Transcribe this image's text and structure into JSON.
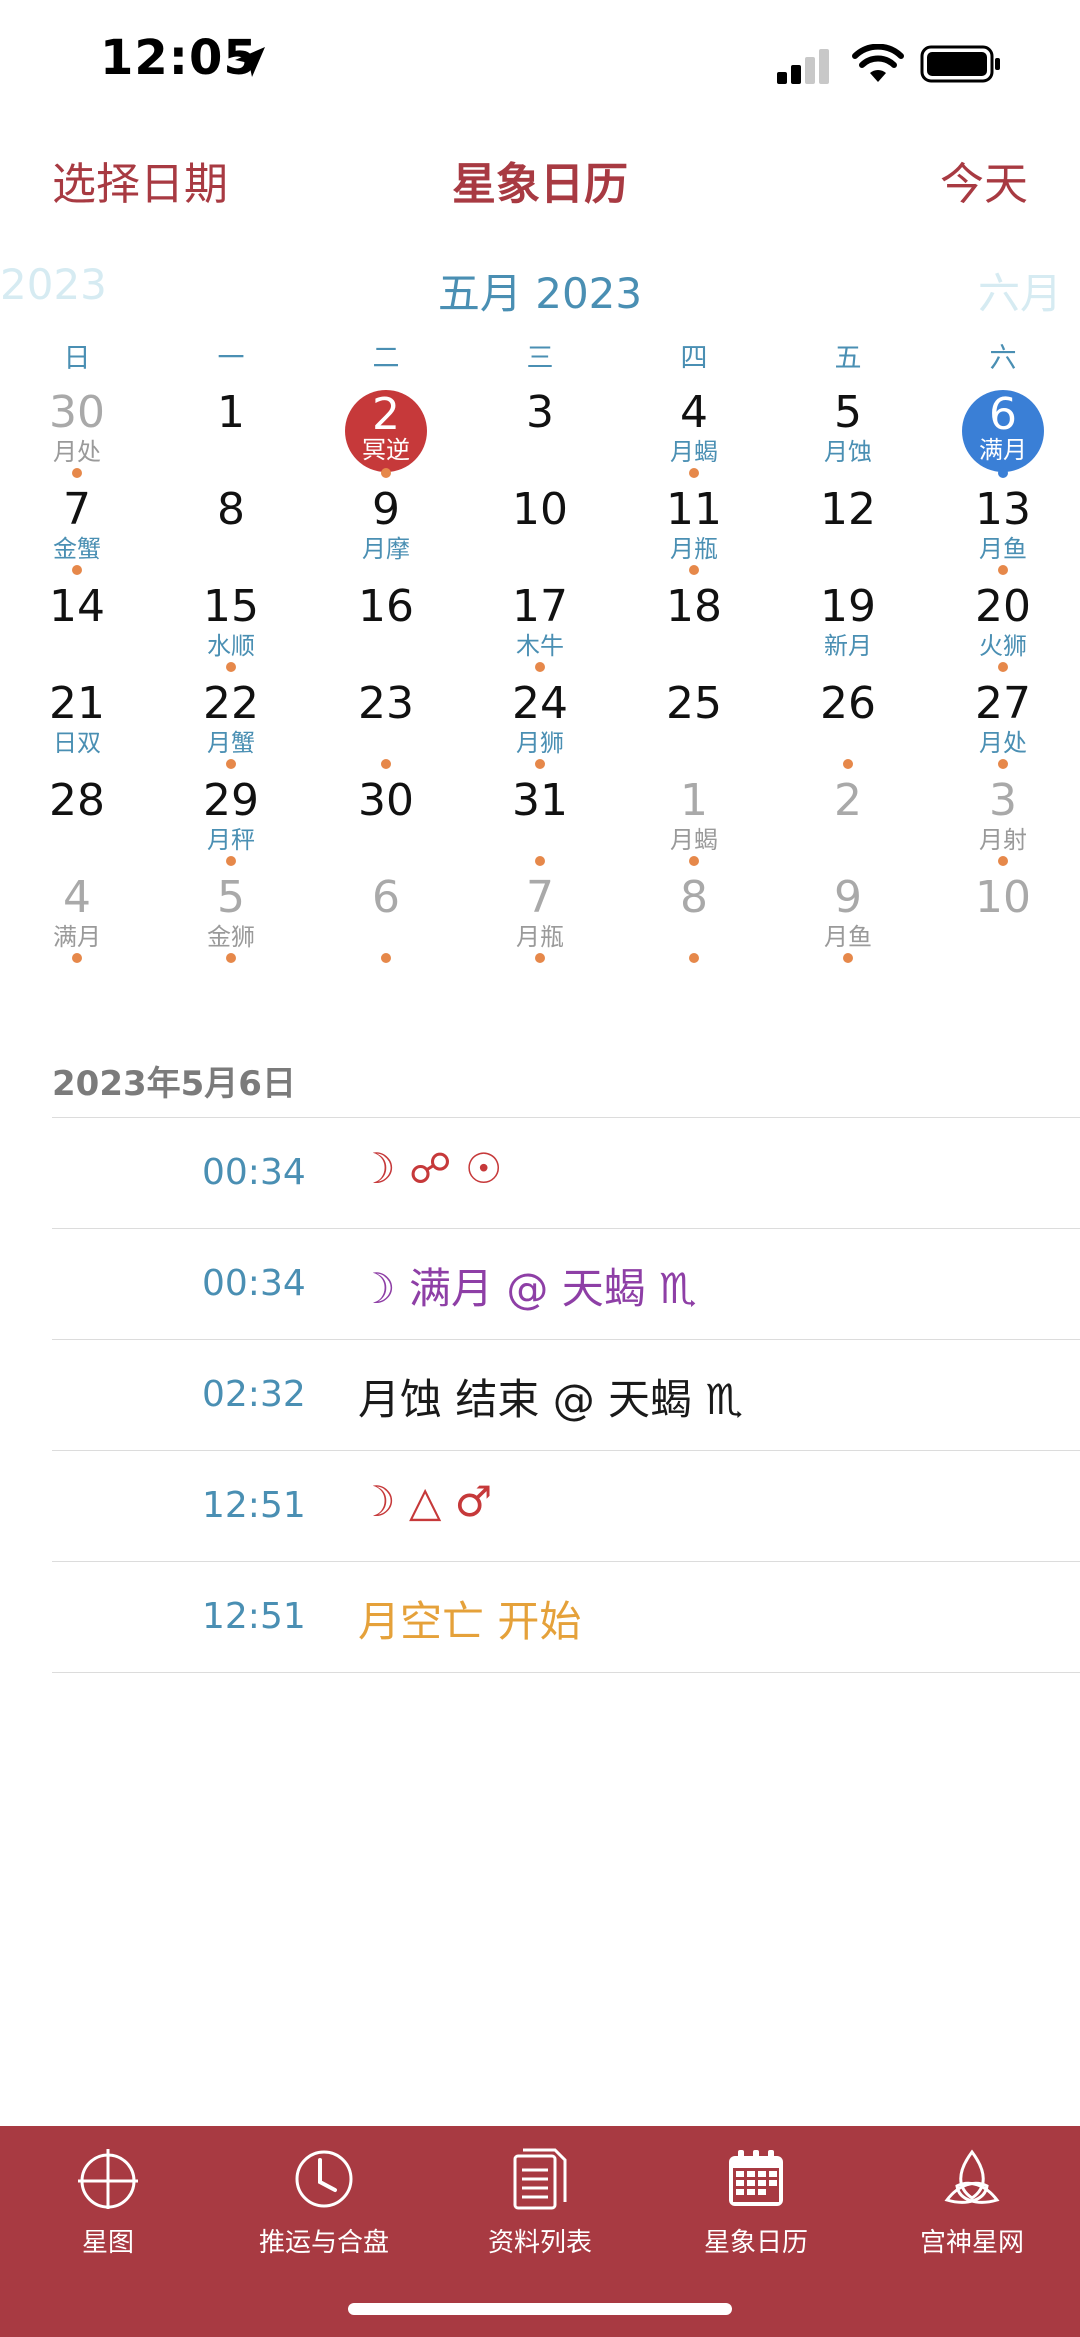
{
  "status_bar": {
    "time": "12:05"
  },
  "nav": {
    "left": "选择日期",
    "title": "星象日历",
    "right": "今天"
  },
  "month_header": {
    "prev": "2023",
    "current": "五月 2023",
    "next": "六月"
  },
  "weekdays": [
    "日",
    "一",
    "二",
    "三",
    "四",
    "五",
    "六"
  ],
  "calendar": {
    "weeks": [
      [
        {
          "d": "30",
          "s": "月处",
          "m": true,
          "dot": true
        },
        {
          "d": "1",
          "s": "",
          "dot": false
        },
        {
          "d": "2",
          "s": "冥逆",
          "hl": "red",
          "dot": true
        },
        {
          "d": "3",
          "s": "",
          "dot": false
        },
        {
          "d": "4",
          "s": "月蝎",
          "dot": true
        },
        {
          "d": "5",
          "s": "月蚀",
          "dot": false
        },
        {
          "d": "6",
          "s": "满月",
          "hl": "blue",
          "dot": true,
          "blue": true
        }
      ],
      [
        {
          "d": "7",
          "s": "金蟹",
          "dot": true
        },
        {
          "d": "8",
          "s": "",
          "dot": false
        },
        {
          "d": "9",
          "s": "月摩",
          "dot": false
        },
        {
          "d": "10",
          "s": "",
          "dot": false
        },
        {
          "d": "11",
          "s": "月瓶",
          "dot": true
        },
        {
          "d": "12",
          "s": "",
          "dot": false
        },
        {
          "d": "13",
          "s": "月鱼",
          "dot": true
        }
      ],
      [
        {
          "d": "14",
          "s": "",
          "dot": false
        },
        {
          "d": "15",
          "s": "水顺",
          "dot": true
        },
        {
          "d": "16",
          "s": "",
          "dot": false
        },
        {
          "d": "17",
          "s": "木牛",
          "dot": true
        },
        {
          "d": "18",
          "s": "",
          "dot": false
        },
        {
          "d": "19",
          "s": "新月",
          "dot": false
        },
        {
          "d": "20",
          "s": "火狮",
          "dot": true
        }
      ],
      [
        {
          "d": "21",
          "s": "日双",
          "dot": false
        },
        {
          "d": "22",
          "s": "月蟹",
          "dot": true
        },
        {
          "d": "23",
          "s": "",
          "dot": true
        },
        {
          "d": "24",
          "s": "月狮",
          "dot": true
        },
        {
          "d": "25",
          "s": "",
          "dot": false
        },
        {
          "d": "26",
          "s": "",
          "dot": true
        },
        {
          "d": "27",
          "s": "月处",
          "dot": true
        }
      ],
      [
        {
          "d": "28",
          "s": "",
          "dot": false
        },
        {
          "d": "29",
          "s": "月秤",
          "dot": true
        },
        {
          "d": "30",
          "s": "",
          "dot": false
        },
        {
          "d": "31",
          "s": "",
          "dot": true
        },
        {
          "d": "1",
          "s": "月蝎",
          "m": true,
          "dot": true
        },
        {
          "d": "2",
          "s": "",
          "m": true,
          "dot": false
        },
        {
          "d": "3",
          "s": "月射",
          "m": true,
          "dot": true
        }
      ],
      [
        {
          "d": "4",
          "s": "满月",
          "m": true,
          "dot": true
        },
        {
          "d": "5",
          "s": "金狮",
          "m": true,
          "dot": true
        },
        {
          "d": "6",
          "s": "",
          "m": true,
          "dot": true
        },
        {
          "d": "7",
          "s": "月瓶",
          "m": true,
          "dot": true
        },
        {
          "d": "8",
          "s": "",
          "m": true,
          "dot": true
        },
        {
          "d": "9",
          "s": "月鱼",
          "m": true,
          "dot": true
        },
        {
          "d": "10",
          "s": "",
          "m": true,
          "dot": false
        }
      ]
    ]
  },
  "selected_date": "2023年5月6日",
  "events": [
    {
      "time": "00:34",
      "text": "☽ ☍ ☉",
      "color": "#c6393a"
    },
    {
      "time": "00:34",
      "text": "☽ 满月 @ 天蝎 ♏",
      "color": "#8e3fa6"
    },
    {
      "time": "02:32",
      "text": "月蚀 结束 @ 天蝎 ♏",
      "color": "#1a1a1a"
    },
    {
      "time": "12:51",
      "text": "☽ △ ♂",
      "color": "#c6393a"
    },
    {
      "time": "12:51",
      "text": "月空亡 开始",
      "color": "#e5a13a"
    }
  ],
  "tabs": [
    {
      "label": "星图",
      "icon": "chart-crosshair-icon"
    },
    {
      "label": "推运与合盘",
      "icon": "clock-icon"
    },
    {
      "label": "资料列表",
      "icon": "document-list-icon"
    },
    {
      "label": "星象日历",
      "icon": "calendar-icon"
    },
    {
      "label": "宫神星网",
      "icon": "triquetra-icon"
    }
  ],
  "colors": {
    "accent": "#a83a42",
    "blue": "#4a8fb3",
    "dot": "#e6884a",
    "highlight_red": "#c6393a",
    "highlight_blue": "#3a7fd6"
  }
}
